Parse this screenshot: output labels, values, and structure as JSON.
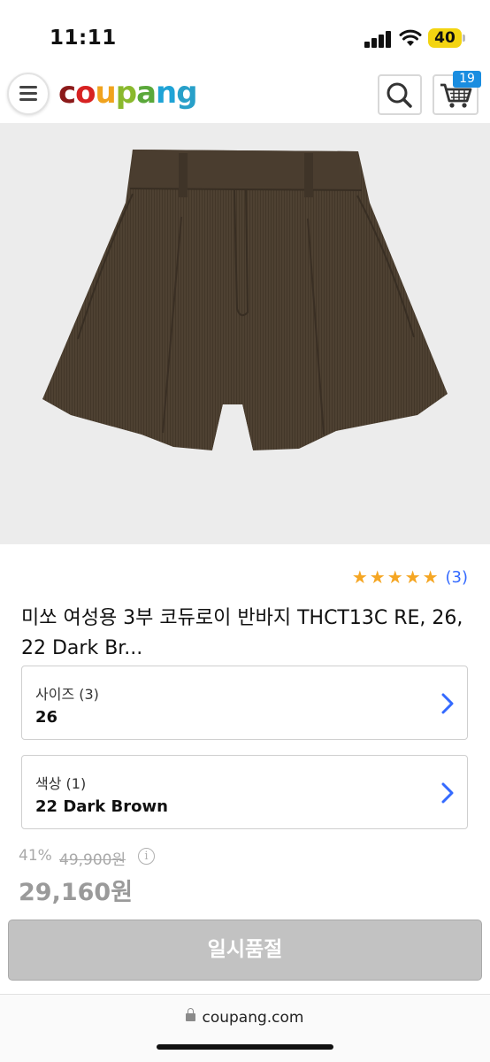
{
  "status_bar": {
    "time": "11:11",
    "battery": "40"
  },
  "header": {
    "logo": {
      "letters": [
        "c",
        "o",
        "u",
        "p",
        "a",
        "n",
        "g"
      ]
    },
    "cart_count": "19"
  },
  "product": {
    "rating_stars": 5,
    "review_count": "(3)",
    "title": "미쏘 여성용 3부 코듀로이 반바지 THCT13C RE, 26, 22 Dark Br...",
    "options": [
      {
        "label": "사이즈 (3)",
        "value": "26"
      },
      {
        "label": "색상 (1)",
        "value": "22 Dark Brown"
      }
    ],
    "discount_rate": "41%",
    "original_price": "49,900원",
    "sale_price": "29,160원",
    "soldout_label": "일시품절"
  },
  "browser": {
    "url": "coupang.com"
  },
  "colors": {
    "accent_blue": "#346aff",
    "star": "#f5a623",
    "badge": "#1a8de0",
    "logo": [
      "#8b1a1a",
      "#d72222",
      "#f0a31e",
      "#8ab92d",
      "#5aa83a",
      "#1fa3d6",
      "#28a0c9"
    ]
  }
}
